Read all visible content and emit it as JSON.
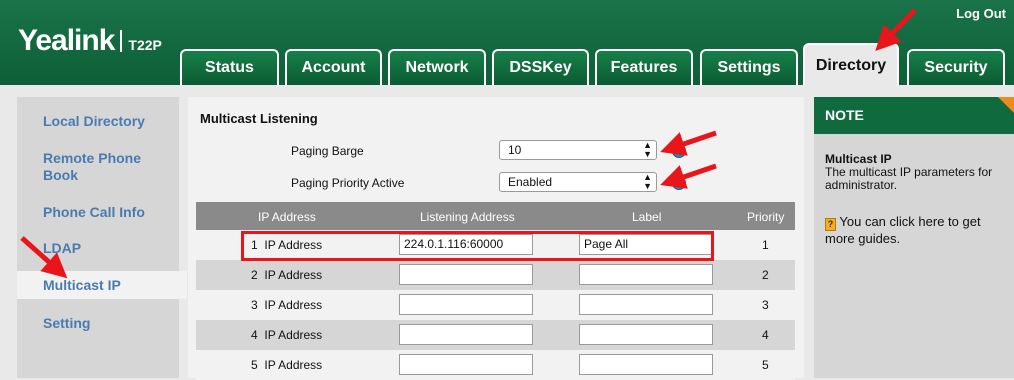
{
  "header": {
    "brand": "Yealink",
    "model": "T22P",
    "logout_label": "Log Out"
  },
  "tabs": [
    {
      "label": "Status"
    },
    {
      "label": "Account"
    },
    {
      "label": "Network"
    },
    {
      "label": "DSSKey"
    },
    {
      "label": "Features"
    },
    {
      "label": "Settings"
    },
    {
      "label": "Directory",
      "active": true
    },
    {
      "label": "Security"
    }
  ],
  "sidebar": {
    "items": [
      {
        "label": "Local Directory"
      },
      {
        "label": "Remote Phone Book"
      },
      {
        "label": "Phone Call Info"
      },
      {
        "label": "LDAP"
      },
      {
        "label": "Multicast IP",
        "active": true
      },
      {
        "label": "Setting"
      }
    ]
  },
  "main": {
    "section_title": "Multicast Listening",
    "paging_barge": {
      "label": "Paging Barge",
      "value": "10"
    },
    "paging_priority": {
      "label": "Paging Priority Active",
      "value": "Enabled"
    },
    "table": {
      "headers": [
        "IP Address",
        "Listening Address",
        "Label",
        "Priority"
      ],
      "rows": [
        {
          "num": "1",
          "name": "IP Address",
          "address": "224.0.1.116:60000",
          "label": "Page All",
          "priority": "1"
        },
        {
          "num": "2",
          "name": "IP Address",
          "address": "",
          "label": "",
          "priority": "2"
        },
        {
          "num": "3",
          "name": "IP Address",
          "address": "",
          "label": "",
          "priority": "3"
        },
        {
          "num": "4",
          "name": "IP Address",
          "address": "",
          "label": "",
          "priority": "4"
        },
        {
          "num": "5",
          "name": "IP Address",
          "address": "",
          "label": "",
          "priority": "5"
        }
      ]
    }
  },
  "note": {
    "heading": "NOTE",
    "title": "Multicast IP",
    "description": "The multicast IP parameters for administrator.",
    "guide_icon": "?",
    "guide_text": "You can click here to get more guides."
  },
  "colors": {
    "header_green": "#0d5f37",
    "link_blue": "#4a7bb0",
    "table_head_gray": "#8a8a8a",
    "annotation_red": "#e8151b",
    "note_corner_orange": "#f08a1c"
  }
}
